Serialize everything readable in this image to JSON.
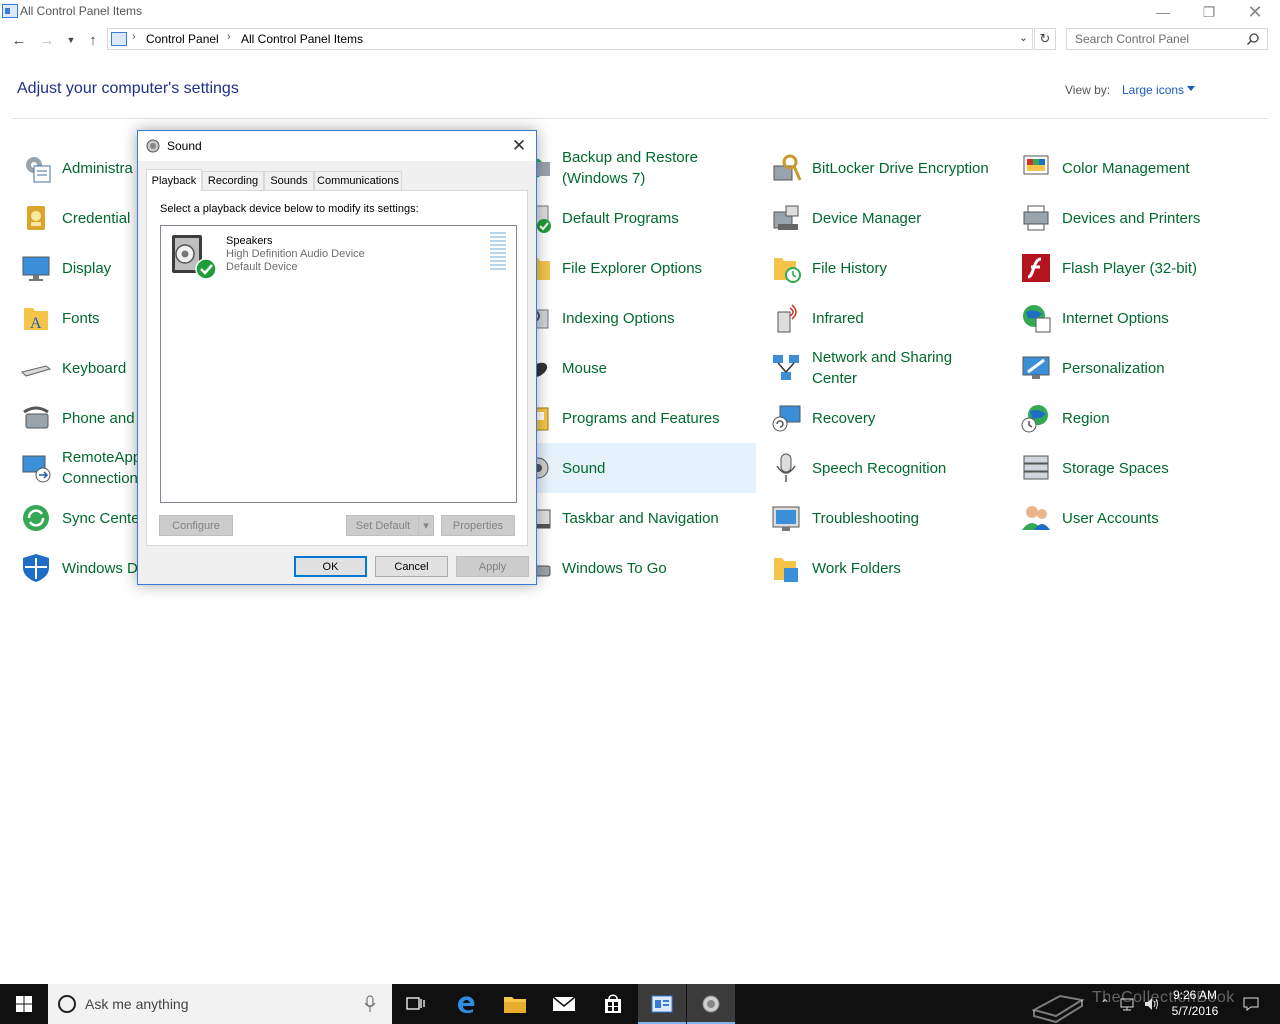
{
  "window": {
    "title": "All Control Panel Items"
  },
  "address": {
    "crumbs": [
      "Control Panel",
      "All Control Panel Items"
    ],
    "search_placeholder": "Search Control Panel"
  },
  "header": {
    "title": "Adjust your computer's settings",
    "view_by_label": "View by:",
    "view_by_value": "Large icons"
  },
  "items": [
    {
      "label": "Administra",
      "icon": "administrative-tools-icon"
    },
    {
      "label": "Credential",
      "icon": "credential-manager-icon"
    },
    {
      "label": "Display",
      "icon": "display-icon"
    },
    {
      "label": "Fonts",
      "icon": "fonts-icon"
    },
    {
      "label": "Keyboard",
      "icon": "keyboard-icon"
    },
    {
      "label": "Phone and",
      "icon": "phone-modem-icon"
    },
    {
      "label": "RemoteApp\nConnection",
      "icon": "remoteapp-icon"
    },
    {
      "label": "Sync Cente",
      "icon": "sync-center-icon"
    },
    {
      "label": "Windows D",
      "icon": "windows-defender-icon"
    },
    {
      "label": "Backup and Restore\n(Windows 7)",
      "icon": "backup-restore-icon"
    },
    {
      "label": "Default Programs",
      "icon": "default-programs-icon"
    },
    {
      "label": "File Explorer Options",
      "icon": "file-explorer-options-icon"
    },
    {
      "label": "Indexing Options",
      "icon": "indexing-options-icon"
    },
    {
      "label": "Mouse",
      "icon": "mouse-icon"
    },
    {
      "label": "Programs and Features",
      "icon": "programs-features-icon"
    },
    {
      "label": "Sound",
      "icon": "sound-icon"
    },
    {
      "label": "Taskbar and Navigation",
      "icon": "taskbar-navigation-icon"
    },
    {
      "label": "Windows To Go",
      "icon": "windows-to-go-icon"
    },
    {
      "label": "BitLocker Drive Encryption",
      "icon": "bitlocker-icon"
    },
    {
      "label": "Device Manager",
      "icon": "device-manager-icon"
    },
    {
      "label": "File History",
      "icon": "file-history-icon"
    },
    {
      "label": "Infrared",
      "icon": "infrared-icon"
    },
    {
      "label": "Network and Sharing\nCenter",
      "icon": "network-sharing-icon"
    },
    {
      "label": "Recovery",
      "icon": "recovery-icon"
    },
    {
      "label": "Speech Recognition",
      "icon": "speech-recognition-icon"
    },
    {
      "label": "Troubleshooting",
      "icon": "troubleshooting-icon"
    },
    {
      "label": "Work Folders",
      "icon": "work-folders-icon"
    },
    {
      "label": "Color Management",
      "icon": "color-management-icon"
    },
    {
      "label": "Devices and Printers",
      "icon": "devices-printers-icon"
    },
    {
      "label": "Flash Player (32-bit)",
      "icon": "flash-player-icon"
    },
    {
      "label": "Internet Options",
      "icon": "internet-options-icon"
    },
    {
      "label": "Personalization",
      "icon": "personalization-icon"
    },
    {
      "label": "Region",
      "icon": "region-icon"
    },
    {
      "label": "Storage Spaces",
      "icon": "storage-spaces-icon"
    },
    {
      "label": "User Accounts",
      "icon": "user-accounts-icon"
    }
  ],
  "dialog": {
    "title": "Sound",
    "tabs": [
      "Playback",
      "Recording",
      "Sounds",
      "Communications"
    ],
    "active_tab": "Playback",
    "instructions": "Select a playback device below to modify its settings:",
    "device": {
      "name": "Speakers",
      "description": "High Definition Audio Device",
      "status": "Default Device"
    },
    "buttons": {
      "configure": "Configure",
      "set_default": "Set Default",
      "properties": "Properties",
      "ok": "OK",
      "cancel": "Cancel",
      "apply": "Apply"
    }
  },
  "taskbar": {
    "search_placeholder": "Ask me anything",
    "time": "9:26 AM",
    "date": "5/7/2016",
    "watermark": "TheCollectionBook"
  },
  "colors": {
    "link_green": "#006a2c",
    "heading_blue": "#1e3287",
    "accent": "#0078d7"
  }
}
